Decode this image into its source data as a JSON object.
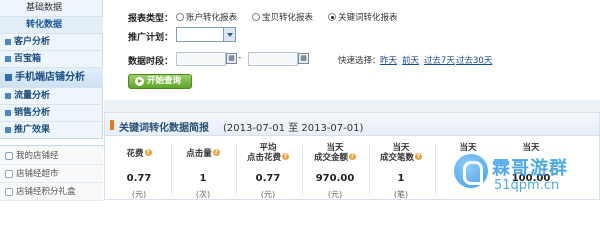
{
  "sidebar": {
    "top_items": [
      {
        "label": "基础数据"
      },
      {
        "label": "转化数据"
      }
    ],
    "main_items": [
      {
        "label": "客户分析"
      },
      {
        "label": "百宝箱"
      }
    ],
    "section_header": "手机端店铺分析",
    "sub_items": [
      {
        "label": "流量分析"
      },
      {
        "label": "销售分析"
      },
      {
        "label": "推广效果"
      }
    ],
    "lower_items": [
      {
        "label": "我的店铺经"
      },
      {
        "label": "店铺经超市"
      },
      {
        "label": "店铺经积分礼盒"
      }
    ]
  },
  "filter": {
    "report_type_label": "报表类型：",
    "report_types": [
      {
        "label": "账户转化报表",
        "selected": false
      },
      {
        "label": "宝贝转化报表",
        "selected": false
      },
      {
        "label": "关键词转化报表",
        "selected": true
      }
    ],
    "plan_label": "推广计划：",
    "plan_value": "",
    "date_label": "数据时段：",
    "date_from": "",
    "date_to": "",
    "date_separator": "-",
    "quick_label": "快速选择：",
    "quick_links": [
      "昨天",
      "前天",
      "过去7天",
      "过去30天"
    ],
    "query_button": "开始查询"
  },
  "report": {
    "title": "关键词转化数据简报",
    "range": "(2013-07-01 至 2013-07-01)",
    "metrics": [
      {
        "label_line1": "花费",
        "label_line2": "",
        "value": "0.77",
        "unit": "(元)"
      },
      {
        "label_line1": "点击量",
        "label_line2": "",
        "value": "1",
        "unit": "(次)"
      },
      {
        "label_line1": "平均",
        "label_line2": "点击花费",
        "value": "0.77",
        "unit": "(元)"
      },
      {
        "label_line1": "当天",
        "label_line2": "成交金额",
        "value": "970.00",
        "unit": "(元)"
      },
      {
        "label_line1": "当天",
        "label_line2": "成交笔数",
        "value": "1",
        "unit": "(笔)"
      },
      {
        "label_line1": "当天",
        "label_line2": "",
        "value": "",
        "unit": ""
      },
      {
        "label_line1": "当天",
        "label_line2": "",
        "value": "100.00",
        "unit": ""
      }
    ]
  },
  "watermark": {
    "name": "霖哥游群",
    "url": "51qpm.cn"
  },
  "colors": {
    "accent": "#1a4d80",
    "link": "#1a4d9c",
    "button": "#5fa52b",
    "help_icon": "#f1a13c",
    "title_bar": "#e57a1e"
  }
}
